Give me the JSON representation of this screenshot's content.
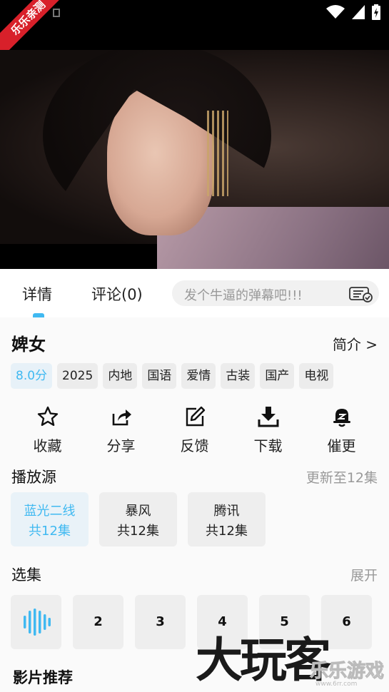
{
  "ribbon": {
    "text": "乐乐亲测"
  },
  "tabs": {
    "detail": "详情",
    "comments": "评论(0)"
  },
  "danmaku": {
    "placeholder": "发个牛逼的弹幕吧!!!"
  },
  "show": {
    "title": "婢女",
    "intro_link": "简介 >"
  },
  "tags": [
    "8.0分",
    "2025",
    "内地",
    "国语",
    "爱情",
    "古装",
    "国产",
    "电视"
  ],
  "actions": [
    {
      "label": "收藏",
      "icon": "star-icon"
    },
    {
      "label": "分享",
      "icon": "share-icon"
    },
    {
      "label": "反馈",
      "icon": "edit-icon"
    },
    {
      "label": "下载",
      "icon": "download-icon"
    },
    {
      "label": "催更",
      "icon": "bell-icon"
    }
  ],
  "sources_section": {
    "title": "播放源",
    "update_status": "更新至12集"
  },
  "sources": [
    {
      "name": "蓝光二线",
      "count": "共12集",
      "active": true
    },
    {
      "name": "暴风",
      "count": "共12集",
      "active": false
    },
    {
      "name": "腾讯",
      "count": "共12集",
      "active": false
    }
  ],
  "episodes_section": {
    "title": "选集",
    "expand": "展开"
  },
  "episodes": [
    "2",
    "3",
    "4",
    "5",
    "6"
  ],
  "recommend": {
    "title": "影片推荐"
  },
  "watermark": {
    "big": "大玩客",
    "small": "乐乐游戏",
    "url": "www.6rr.com"
  },
  "colors": {
    "accent": "#40b9f1",
    "ribbon": "#d8202a"
  }
}
